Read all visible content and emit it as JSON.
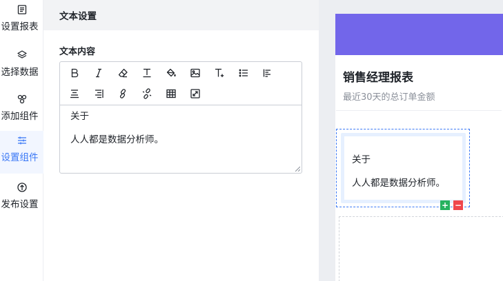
{
  "sidebar": {
    "items": [
      {
        "label": "设置报表",
        "icon": "report-settings-icon"
      },
      {
        "label": "选择数据",
        "icon": "layers-icon"
      },
      {
        "label": "添加组件",
        "icon": "components-icon"
      },
      {
        "label": "设置组件",
        "icon": "sliders-icon",
        "active": true
      },
      {
        "label": "发布设置",
        "icon": "publish-icon"
      }
    ]
  },
  "panel": {
    "title": "文本设置",
    "field_label": "文本内容",
    "toolbar": [
      "bold-icon",
      "italic-icon",
      "eraser-icon",
      "text-style-icon",
      "fill-color-icon",
      "image-icon",
      "font-size-icon",
      "bullet-list-icon",
      "align-left-icon",
      "align-center-icon",
      "align-right-icon",
      "link-icon",
      "unlink-icon",
      "table-icon",
      "fullscreen-icon"
    ],
    "content": {
      "line1": "关于",
      "line2": "人人都是数据分析师。"
    }
  },
  "preview": {
    "report_title": "销售经理报表",
    "report_subtitle": "最近30天的总订单金额",
    "card": {
      "line1": "关于",
      "line2": "人人都是数据分析师。"
    },
    "add_symbol": "+",
    "remove_symbol": "−"
  },
  "colors": {
    "accent": "#3a78f6",
    "banner": "#7266ea",
    "add": "#27b25f",
    "remove": "#f0474c"
  }
}
